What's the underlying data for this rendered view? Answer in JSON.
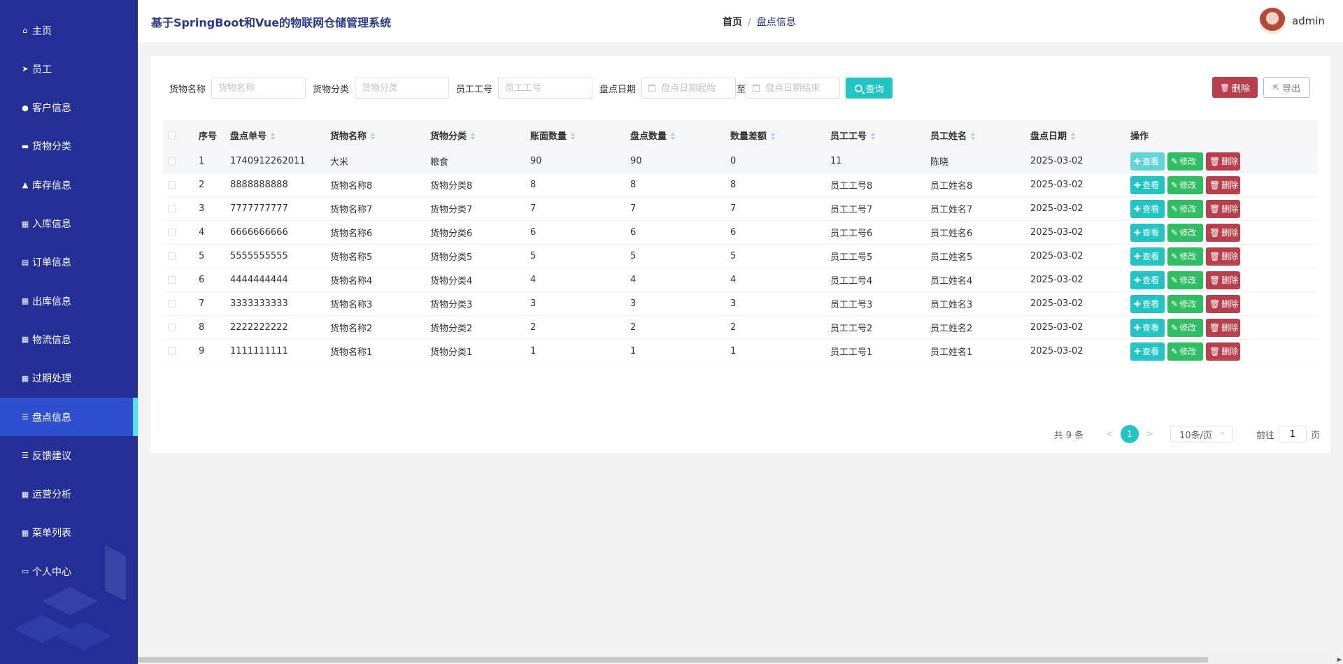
{
  "app": {
    "title": "基于SpringBoot和Vue的物联网仓储管理系统",
    "user": "admin",
    "accent": "#23c4c4",
    "sidebar_bg": "#232f95"
  },
  "breadcrumb": {
    "home": "首页",
    "sep": "/",
    "current": "盘点信息"
  },
  "sidebar": {
    "items": [
      {
        "label": "主页",
        "icon": "home-icon"
      },
      {
        "label": "员工",
        "icon": "send-icon"
      },
      {
        "label": "客户信息",
        "icon": "user-icon"
      },
      {
        "label": "货物分类",
        "icon": "briefcase-icon"
      },
      {
        "label": "库存信息",
        "icon": "bank-icon"
      },
      {
        "label": "入库信息",
        "icon": "grid-icon"
      },
      {
        "label": "订单信息",
        "icon": "clipboard-icon"
      },
      {
        "label": "出库信息",
        "icon": "grid-icon"
      },
      {
        "label": "物流信息",
        "icon": "grid-icon"
      },
      {
        "label": "过期处理",
        "icon": "grid-icon"
      },
      {
        "label": "盘点信息",
        "icon": "list-icon",
        "active": true
      },
      {
        "label": "反馈建议",
        "icon": "list-icon"
      },
      {
        "label": "运营分析",
        "icon": "grid-icon"
      },
      {
        "label": "菜单列表",
        "icon": "table-icon"
      },
      {
        "label": "个人中心",
        "icon": "calendar-icon"
      }
    ]
  },
  "search": {
    "goods_name_label": "货物名称",
    "goods_name_placeholder": "货物名称",
    "goods_cat_label": "货物分类",
    "goods_cat_placeholder": "货物分类",
    "emp_no_label": "员工工号",
    "emp_no_placeholder": "员工工号",
    "date_label": "盘点日期",
    "date_start_placeholder": "盘点日期起始",
    "date_to": "至",
    "date_end_placeholder": "盘点日期结束",
    "query_label": "查询"
  },
  "actions": {
    "delete_label": "删除",
    "export_label": "导出"
  },
  "table": {
    "headers": [
      "序号",
      "盘点单号",
      "货物名称",
      "货物分类",
      "账面数量",
      "盘点数量",
      "数量差额",
      "员工工号",
      "员工姓名",
      "盘点日期",
      "操作"
    ],
    "op_view": "查看",
    "op_edit": "修改",
    "op_delete": "删除",
    "rows": [
      [
        "1",
        "1740912262011",
        "大米",
        "粮食",
        "90",
        "90",
        "0",
        "11",
        "陈晓",
        "2025-03-02"
      ],
      [
        "2",
        "8888888888",
        "货物名称8",
        "货物分类8",
        "8",
        "8",
        "8",
        "员工工号8",
        "员工姓名8",
        "2025-03-02"
      ],
      [
        "3",
        "7777777777",
        "货物名称7",
        "货物分类7",
        "7",
        "7",
        "7",
        "员工工号7",
        "员工姓名7",
        "2025-03-02"
      ],
      [
        "4",
        "6666666666",
        "货物名称6",
        "货物分类6",
        "6",
        "6",
        "6",
        "员工工号6",
        "员工姓名6",
        "2025-03-02"
      ],
      [
        "5",
        "5555555555",
        "货物名称5",
        "货物分类5",
        "5",
        "5",
        "5",
        "员工工号5",
        "员工姓名5",
        "2025-03-02"
      ],
      [
        "6",
        "4444444444",
        "货物名称4",
        "货物分类4",
        "4",
        "4",
        "4",
        "员工工号4",
        "员工姓名4",
        "2025-03-02"
      ],
      [
        "7",
        "3333333333",
        "货物名称3",
        "货物分类3",
        "3",
        "3",
        "3",
        "员工工号3",
        "员工姓名3",
        "2025-03-02"
      ],
      [
        "8",
        "2222222222",
        "货物名称2",
        "货物分类2",
        "2",
        "2",
        "2",
        "员工工号2",
        "员工姓名2",
        "2025-03-02"
      ],
      [
        "9",
        "1111111111",
        "货物名称1",
        "货物分类1",
        "1",
        "1",
        "1",
        "员工工号1",
        "员工姓名1",
        "2025-03-02"
      ]
    ]
  },
  "pagination": {
    "total": "共 9 条",
    "prev": "<",
    "current": "1",
    "next": ">",
    "page_size": "10条/页",
    "goto_label": "前往",
    "goto_value": "1",
    "page_suffix": "页"
  }
}
